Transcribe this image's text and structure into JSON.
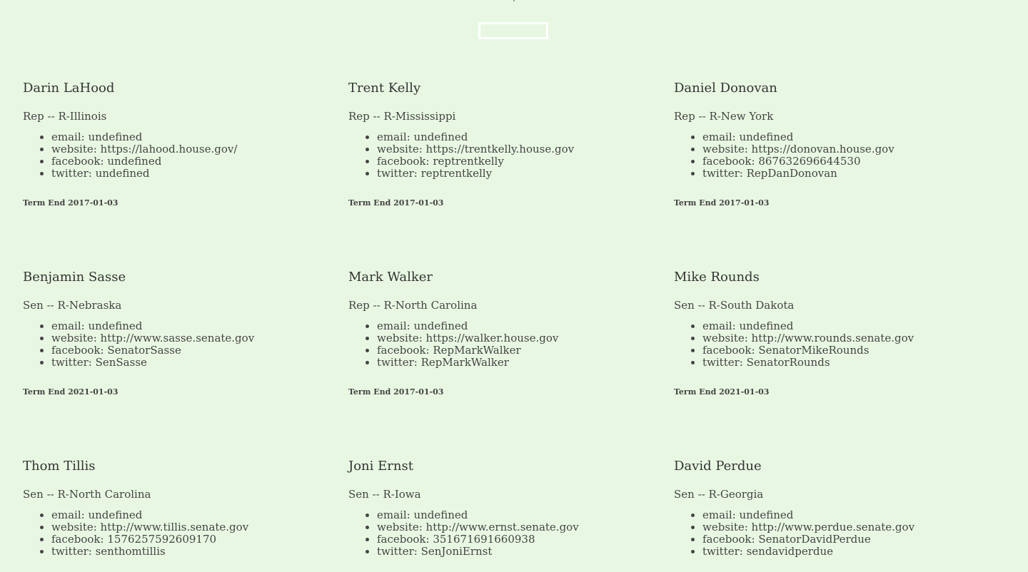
{
  "search": {
    "value": "",
    "placeholder": ""
  },
  "members": [
    {
      "name": "Darin LaHood",
      "role": "Rep -- R-Illinois",
      "email": "email: undefined",
      "website": "website: https://lahood.house.gov/",
      "facebook": "facebook: undefined",
      "twitter": "twitter: undefined",
      "term": "Term End 2017-01-03"
    },
    {
      "name": "Trent Kelly",
      "role": "Rep -- R-Mississippi",
      "email": "email: undefined",
      "website": "website: https://trentkelly.house.gov",
      "facebook": "facebook: reptrentkelly",
      "twitter": "twitter: reptrentkelly",
      "term": "Term End 2017-01-03"
    },
    {
      "name": "Daniel Donovan",
      "role": "Rep -- R-New York",
      "email": "email: undefined",
      "website": "website: https://donovan.house.gov",
      "facebook": "facebook: 867632696644530",
      "twitter": "twitter: RepDanDonovan",
      "term": "Term End 2017-01-03"
    },
    {
      "name": "Benjamin Sasse",
      "role": "Sen -- R-Nebraska",
      "email": "email: undefined",
      "website": "website: http://www.sasse.senate.gov",
      "facebook": "facebook: SenatorSasse",
      "twitter": "twitter: SenSasse",
      "term": "Term End 2021-01-03"
    },
    {
      "name": "Mark Walker",
      "role": "Rep -- R-North Carolina",
      "email": "email: undefined",
      "website": "website: https://walker.house.gov",
      "facebook": "facebook: RepMarkWalker",
      "twitter": "twitter: RepMarkWalker",
      "term": "Term End 2017-01-03"
    },
    {
      "name": "Mike Rounds",
      "role": "Sen -- R-South Dakota",
      "email": "email: undefined",
      "website": "website: http://www.rounds.senate.gov",
      "facebook": "facebook: SenatorMikeRounds",
      "twitter": "twitter: SenatorRounds",
      "term": "Term End 2021-01-03"
    },
    {
      "name": "Thom Tillis",
      "role": "Sen -- R-North Carolina",
      "email": "email: undefined",
      "website": "website: http://www.tillis.senate.gov",
      "facebook": "facebook: 1576257592609170",
      "twitter": "twitter: senthomtillis",
      "term": ""
    },
    {
      "name": "Joni Ernst",
      "role": "Sen -- R-Iowa",
      "email": "email: undefined",
      "website": "website: http://www.ernst.senate.gov",
      "facebook": "facebook: 351671691660938",
      "twitter": "twitter: SenJoniErnst",
      "term": ""
    },
    {
      "name": "David Perdue",
      "role": "Sen -- R-Georgia",
      "email": "email: undefined",
      "website": "website: http://www.perdue.senate.gov",
      "facebook": "facebook: SenatorDavidPerdue",
      "twitter": "twitter: sendavidperdue",
      "term": ""
    }
  ]
}
